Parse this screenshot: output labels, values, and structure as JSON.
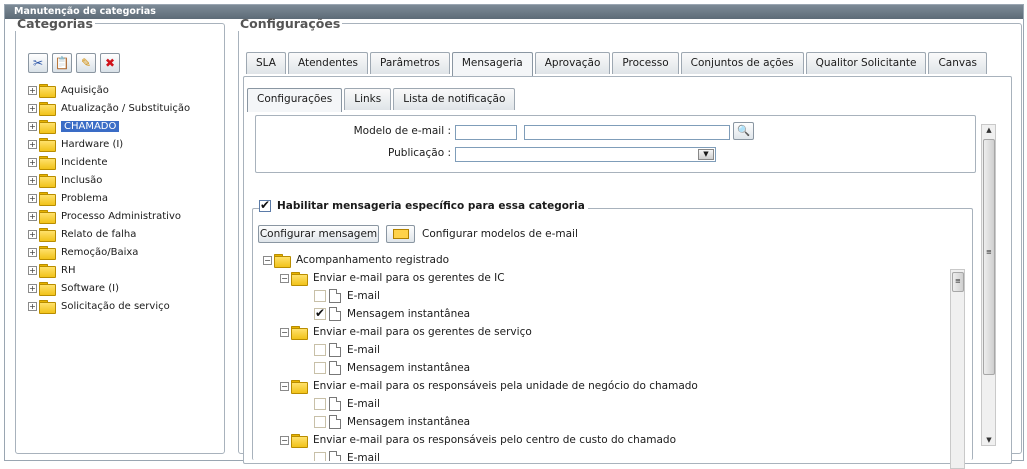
{
  "window": {
    "title": "Manutenção de categorias"
  },
  "categories": {
    "legend": "Categorias",
    "items": [
      "Aquisição",
      "Atualização / Substituição",
      "CHAMADO",
      "Hardware (I)",
      "Incidente",
      "Inclusão",
      "Problema",
      "Processo Administrativo",
      "Relato de falha",
      "Remoção/Baixa",
      "RH",
      "Software (I)",
      "Solicitação de serviço"
    ],
    "selected": "CHAMADO"
  },
  "config": {
    "legend": "Configurações",
    "tabs": [
      "SLA",
      "Atendentes",
      "Parâmetros",
      "Mensageria",
      "Aprovação",
      "Processo",
      "Conjuntos de ações",
      "Qualitor Solicitante",
      "Canvas"
    ],
    "active_tab": "Mensageria",
    "subtabs": [
      "Configurações",
      "Links",
      "Lista de notificação"
    ],
    "active_subtab": "Configurações",
    "email_model_label": "Modelo de e-mail :",
    "publication_label": "Publicação :",
    "enable_label": "Habilitar mensageria específico para essa categoria",
    "enable_checked": true,
    "configure_button": "Configurar mensagem",
    "configure_models_label": "Configurar modelos de e-mail"
  },
  "message_tree": {
    "root": "Acompanhamento registrado",
    "groups": [
      {
        "label": "Enviar e-mail para os gerentes de IC",
        "items": [
          {
            "label": "E-mail",
            "checked": false
          },
          {
            "label": "Mensagem instantânea",
            "checked": true
          }
        ]
      },
      {
        "label": "Enviar e-mail para os gerentes de serviço",
        "items": [
          {
            "label": "E-mail",
            "checked": false
          },
          {
            "label": "Mensagem instantânea",
            "checked": false
          }
        ]
      },
      {
        "label": "Enviar e-mail para os responsáveis pela unidade de negócio do chamado",
        "items": [
          {
            "label": "E-mail",
            "checked": false
          },
          {
            "label": "Mensagem instantânea",
            "checked": false
          }
        ]
      },
      {
        "label": "Enviar e-mail para os responsáveis pelo centro de custo do chamado",
        "items": [
          {
            "label": "E-mail",
            "checked": false
          }
        ]
      }
    ]
  },
  "icons": {
    "cut": "scissors-icon",
    "paste": "paste-icon",
    "edit": "pencil-icon",
    "delete": "delete-icon",
    "email": "envelope-icon",
    "search": "magnifier-icon"
  }
}
